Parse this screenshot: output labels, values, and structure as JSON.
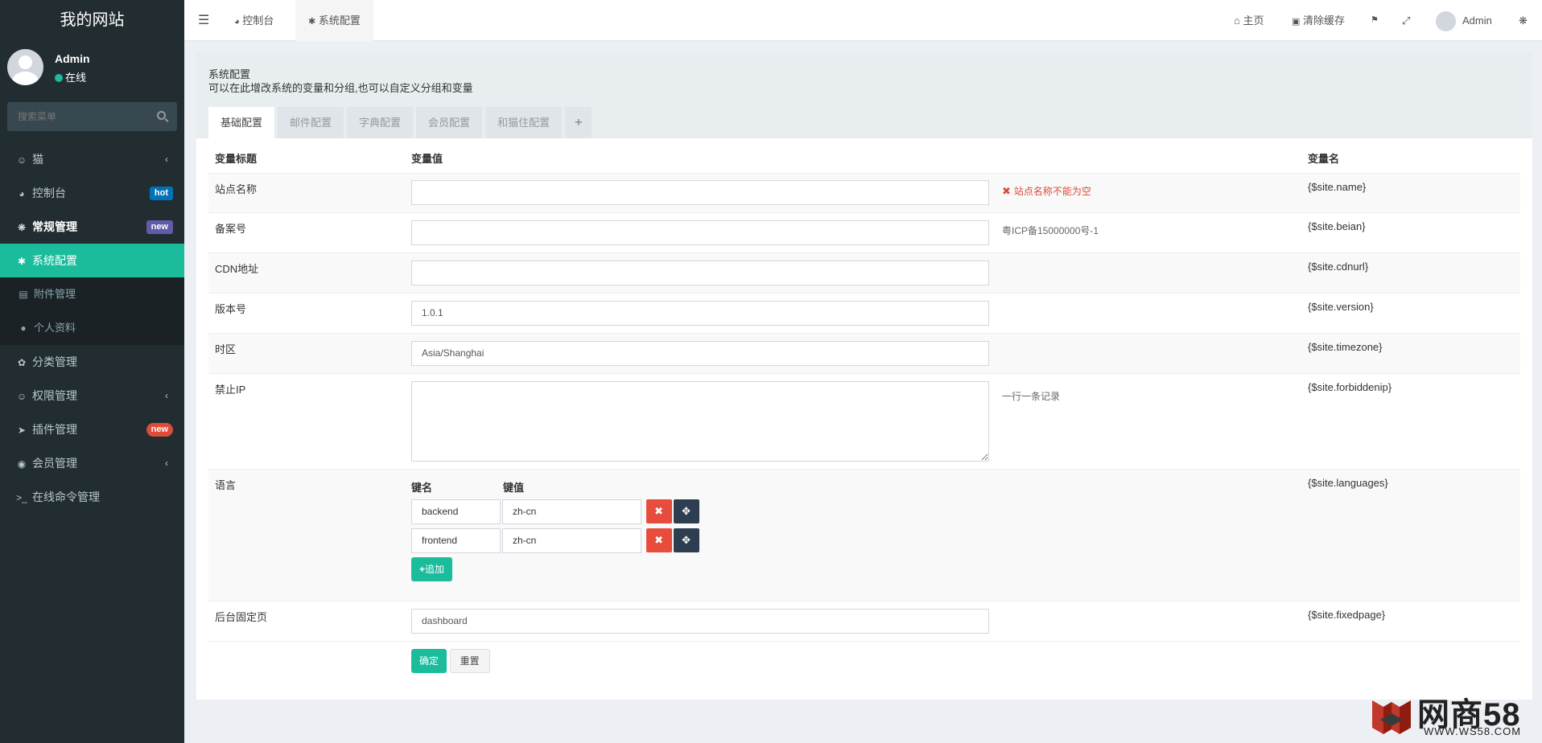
{
  "site": {
    "title": "我的网站"
  },
  "user": {
    "name": "Admin",
    "status": "在线"
  },
  "search": {
    "placeholder": "搜索菜单"
  },
  "menu": [
    {
      "label": "猫",
      "icon": "users-icon",
      "arrow": "‹"
    },
    {
      "label": "控制台",
      "icon": "dashboard-icon",
      "badge": "hot"
    },
    {
      "label": "常规管理",
      "icon": "cogs-icon",
      "badge": "new"
    },
    {
      "label": "系统配置",
      "icon": "gear-icon"
    },
    {
      "label": "附件管理",
      "icon": "file-image-icon"
    },
    {
      "label": "个人资料",
      "icon": "user-icon"
    },
    {
      "label": "分类管理",
      "icon": "leaf-icon"
    },
    {
      "label": "权限管理",
      "icon": "group-icon",
      "arrow": "‹"
    },
    {
      "label": "插件管理",
      "icon": "rocket-icon",
      "badge": "new"
    },
    {
      "label": "会员管理",
      "icon": "user-circle-icon",
      "arrow": "‹"
    },
    {
      "label": "在线命令管理",
      "icon": "terminal-icon"
    }
  ],
  "topbar": {
    "tab1": "控制台",
    "tab2": "系统配置",
    "home": "主页",
    "clear_cache": "清除缓存",
    "user": "Admin"
  },
  "panel": {
    "title": "系统配置",
    "desc": "可以在此增改系统的变量和分组,也可以自定义分组和变量",
    "tabs": [
      "基础配置",
      "邮件配置",
      "字典配置",
      "会员配置",
      "和猫住配置"
    ],
    "tab_plus": "+"
  },
  "table": {
    "headers": {
      "title": "变量标题",
      "value": "变量值",
      "name": "变量名"
    },
    "rows": {
      "site_name": {
        "title": "站点名称",
        "value": "",
        "error": "站点名称不能为空",
        "var": "{$site.name}"
      },
      "beian": {
        "title": "备案号",
        "value": "",
        "tip": "粤ICP备15000000号-1",
        "var": "{$site.beian}"
      },
      "cdn": {
        "title": "CDN地址",
        "value": "",
        "var": "{$site.cdnurl}"
      },
      "version": {
        "title": "版本号",
        "value": "1.0.1",
        "var": "{$site.version}"
      },
      "timezone": {
        "title": "时区",
        "value": "Asia/Shanghai",
        "var": "{$site.timezone}"
      },
      "forbiddenip": {
        "title": "禁止IP",
        "value": "",
        "tip": "一行一条记录",
        "var": "{$site.forbiddenip}"
      },
      "languages": {
        "title": "语言",
        "key_header": "键名",
        "value_header": "键值",
        "items": [
          {
            "key": "backend",
            "value": "zh-cn"
          },
          {
            "key": "frontend",
            "value": "zh-cn"
          }
        ],
        "add": "追加",
        "var": "{$site.languages}"
      },
      "fixedpage": {
        "title": "后台固定页",
        "value": "dashboard",
        "var": "{$site.fixedpage}"
      }
    },
    "submit": "确定",
    "reset": "重置"
  },
  "watermark": {
    "brand": "网商58",
    "url": "WWW.WS58.COM"
  },
  "colors": {
    "accent": "#1abc9c",
    "sidebar": "#222d32",
    "danger": "#e74c3c",
    "dark": "#2c3e50"
  }
}
